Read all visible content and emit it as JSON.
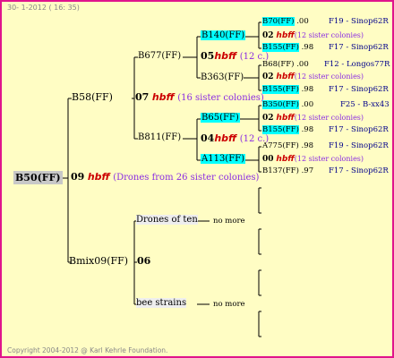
{
  "header": {
    "date": "30-  1-2012 ( 16: 35)"
  },
  "footer": {
    "copyright": "Copyright 2004-2012 @ Karl Kehrle Foundation."
  },
  "root": {
    "name": "B50(FF)",
    "mid_num": "09",
    "mid_code": "hbff",
    "mid_note": "(Drones from 26 sister colonies)"
  },
  "gen1": {
    "b58": "B58(FF)",
    "b58_num": "07",
    "b58_code": "hbff",
    "b58_note": "(16 sister colonies)",
    "bmix": "Bmix09(FF)",
    "bmix_num": "06"
  },
  "gen2": {
    "b677": "B677(FF)",
    "b677_num": "05",
    "b677_code": "hbff",
    "b677_note": "(12 c.)",
    "b811": "B811(FF)",
    "b811_num": "04",
    "b811_code": "hbff",
    "b811_note": "(12 c.)",
    "drones": "Drones of ten",
    "drones_more": "no more",
    "bee": "bee strains",
    "bee_more": "no more"
  },
  "gen3": {
    "b140": "B140(FF)",
    "b140_num": "02",
    "b140_code": "hbff",
    "b140_note": "(12 sister colonies)",
    "b363": "B363(FF)",
    "b363_num": "02",
    "b363_code": "hbff",
    "b363_note": "(12 sister colonies)",
    "b65": "B65(FF)",
    "b65_num": "02",
    "b65_code": "hbff",
    "b65_note": "(12 sister colonies)",
    "a113": "A113(FF)",
    "a113_num": "00",
    "a113_code": "hbff",
    "a113_note": "(12 sister colonies)"
  },
  "rows": [
    {
      "name": "B70(FF)",
      "val": ".00",
      "src": "F19 - Sinop62R"
    },
    {
      "name": "B155(FF)",
      "val": ".98",
      "src": "F17 - Sinop62R"
    },
    {
      "name": "B68(FF)",
      "val": ".00",
      "src": "F12 - Longos77R"
    },
    {
      "name": "B155(FF)",
      "val": ".98",
      "src": "F17 - Sinop62R"
    },
    {
      "name": "B350(FF)",
      "val": ".00",
      "src": "F25 - B-xx43"
    },
    {
      "name": "B155(FF)",
      "val": ".98",
      "src": "F17 - Sinop62R"
    },
    {
      "name": "A775(FF)",
      "val": ".98",
      "src": "F19 - Sinop62R"
    },
    {
      "name": "B137(FF)",
      "val": ".97",
      "src": "F17 - Sinop62R"
    }
  ]
}
